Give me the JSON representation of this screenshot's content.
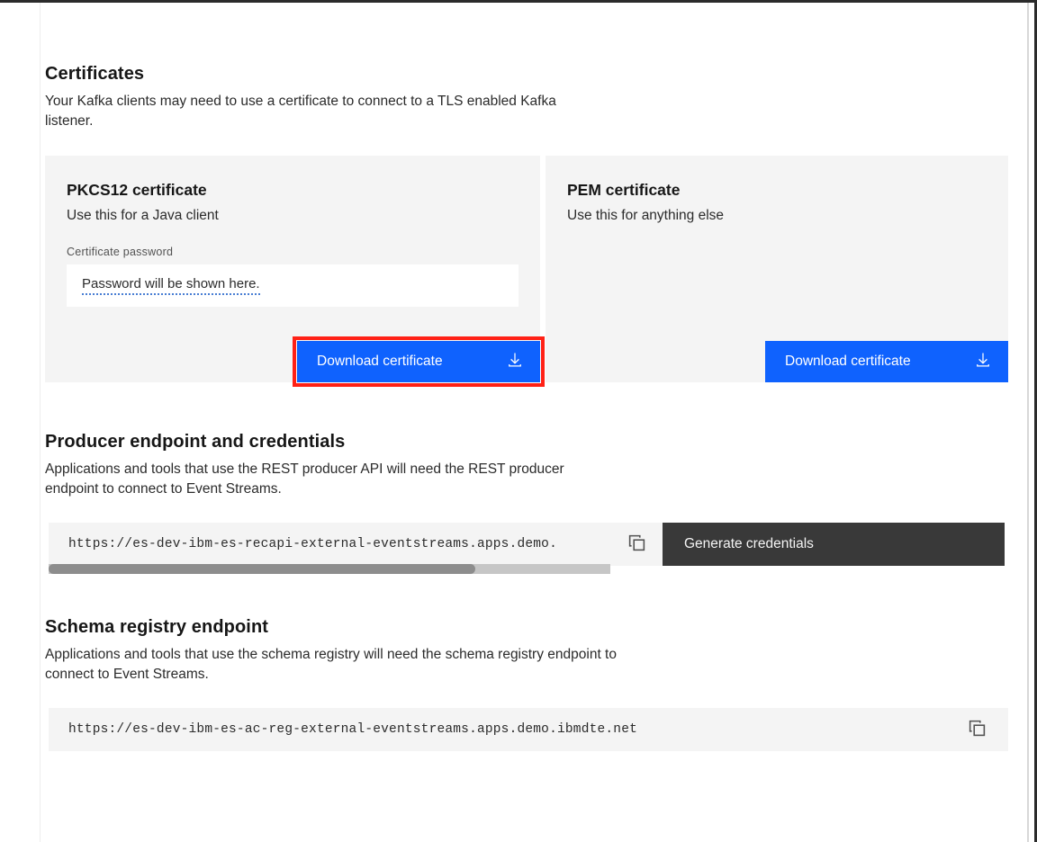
{
  "certificates": {
    "title": "Certificates",
    "description": "Your Kafka clients may need to use a certificate to connect to a TLS enabled Kafka listener.",
    "cards": [
      {
        "title": "PKCS12 certificate",
        "subtitle": "Use this for a Java client",
        "password_label": "Certificate password",
        "password_value": "Password will be shown here.",
        "download_label": "Download certificate",
        "download_icon": "download-icon",
        "highlighted": true
      },
      {
        "title": "PEM certificate",
        "subtitle": "Use this for anything else",
        "download_label": "Download certificate",
        "download_icon": "download-icon",
        "highlighted": false
      }
    ]
  },
  "producer": {
    "title": "Producer endpoint and credentials",
    "description": "Applications and tools that use the REST producer API will need the REST producer endpoint to connect to Event Streams.",
    "endpoint": "https://es-dev-ibm-es-recapi-external-eventstreams.apps.demo.ibmdte.net",
    "endpoint_visible": "https://es-dev-ibm-es-recapi-external-eventstreams.apps.demo.",
    "copy_icon": "copy-icon",
    "generate_label": "Generate credentials",
    "scroll_thumb_percent": 76
  },
  "schema_registry": {
    "title": "Schema registry endpoint",
    "description": "Applications and tools that use the schema registry will need the schema registry endpoint to connect to Event Streams.",
    "endpoint": "https://es-dev-ibm-es-ac-reg-external-eventstreams.apps.demo.ibmdte.net",
    "copy_icon": "copy-icon"
  },
  "colors": {
    "accent_blue": "#0f62fe",
    "highlight_red": "#ff2116",
    "dark_button": "#393939",
    "card_background": "#f4f4f4"
  }
}
